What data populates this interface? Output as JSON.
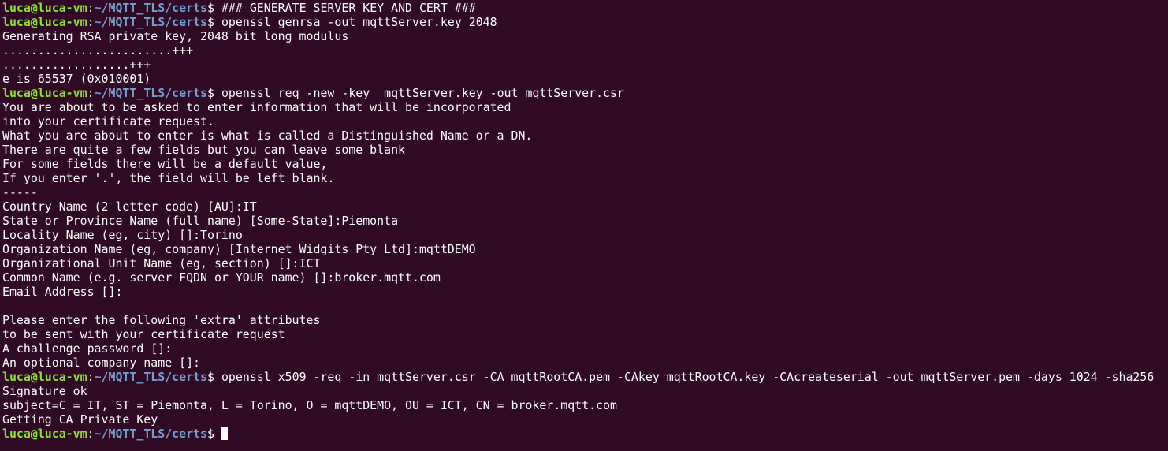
{
  "terminal": {
    "prompt": {
      "user": "luca@luca-vm",
      "sep": ":",
      "path": "~/MQTT_TLS/certs",
      "symbol": "$ "
    },
    "lines": [
      {
        "type": "prompt",
        "text": "### GENERATE SERVER KEY AND CERT ###"
      },
      {
        "type": "prompt",
        "text": "openssl genrsa -out mqttServer.key 2048"
      },
      {
        "type": "output",
        "text": "Generating RSA private key, 2048 bit long modulus"
      },
      {
        "type": "output",
        "text": "........................+++"
      },
      {
        "type": "output",
        "text": "..................+++"
      },
      {
        "type": "output",
        "text": "e is 65537 (0x010001)"
      },
      {
        "type": "prompt",
        "text": "openssl req -new -key  mqttServer.key -out mqttServer.csr"
      },
      {
        "type": "output",
        "text": "You are about to be asked to enter information that will be incorporated"
      },
      {
        "type": "output",
        "text": "into your certificate request."
      },
      {
        "type": "output",
        "text": "What you are about to enter is what is called a Distinguished Name or a DN."
      },
      {
        "type": "output",
        "text": "There are quite a few fields but you can leave some blank"
      },
      {
        "type": "output",
        "text": "For some fields there will be a default value,"
      },
      {
        "type": "output",
        "text": "If you enter '.', the field will be left blank."
      },
      {
        "type": "output",
        "text": "-----"
      },
      {
        "type": "output",
        "text": "Country Name (2 letter code) [AU]:IT"
      },
      {
        "type": "output",
        "text": "State or Province Name (full name) [Some-State]:Piemonta"
      },
      {
        "type": "output",
        "text": "Locality Name (eg, city) []:Torino"
      },
      {
        "type": "output",
        "text": "Organization Name (eg, company) [Internet Widgits Pty Ltd]:mqttDEMO"
      },
      {
        "type": "output",
        "text": "Organizational Unit Name (eg, section) []:ICT"
      },
      {
        "type": "output",
        "text": "Common Name (e.g. server FQDN or YOUR name) []:broker.mqtt.com"
      },
      {
        "type": "output",
        "text": "Email Address []:"
      },
      {
        "type": "output",
        "text": ""
      },
      {
        "type": "output",
        "text": "Please enter the following 'extra' attributes"
      },
      {
        "type": "output",
        "text": "to be sent with your certificate request"
      },
      {
        "type": "output",
        "text": "A challenge password []:"
      },
      {
        "type": "output",
        "text": "An optional company name []:"
      },
      {
        "type": "prompt",
        "text": "openssl x509 -req -in mqttServer.csr -CA mqttRootCA.pem -CAkey mqttRootCA.key -CAcreateserial -out mqttServer.pem -days 1024 -sha256"
      },
      {
        "type": "output",
        "text": "Signature ok"
      },
      {
        "type": "output",
        "text": "subject=C = IT, ST = Piemonta, L = Torino, O = mqttDEMO, OU = ICT, CN = broker.mqtt.com"
      },
      {
        "type": "output",
        "text": "Getting CA Private Key"
      },
      {
        "type": "prompt",
        "text": "",
        "cursor": true
      }
    ]
  },
  "colors": {
    "background": "#300a24",
    "prompt_user": "#8ae234",
    "prompt_path": "#729fcf",
    "text": "#ffffff"
  }
}
